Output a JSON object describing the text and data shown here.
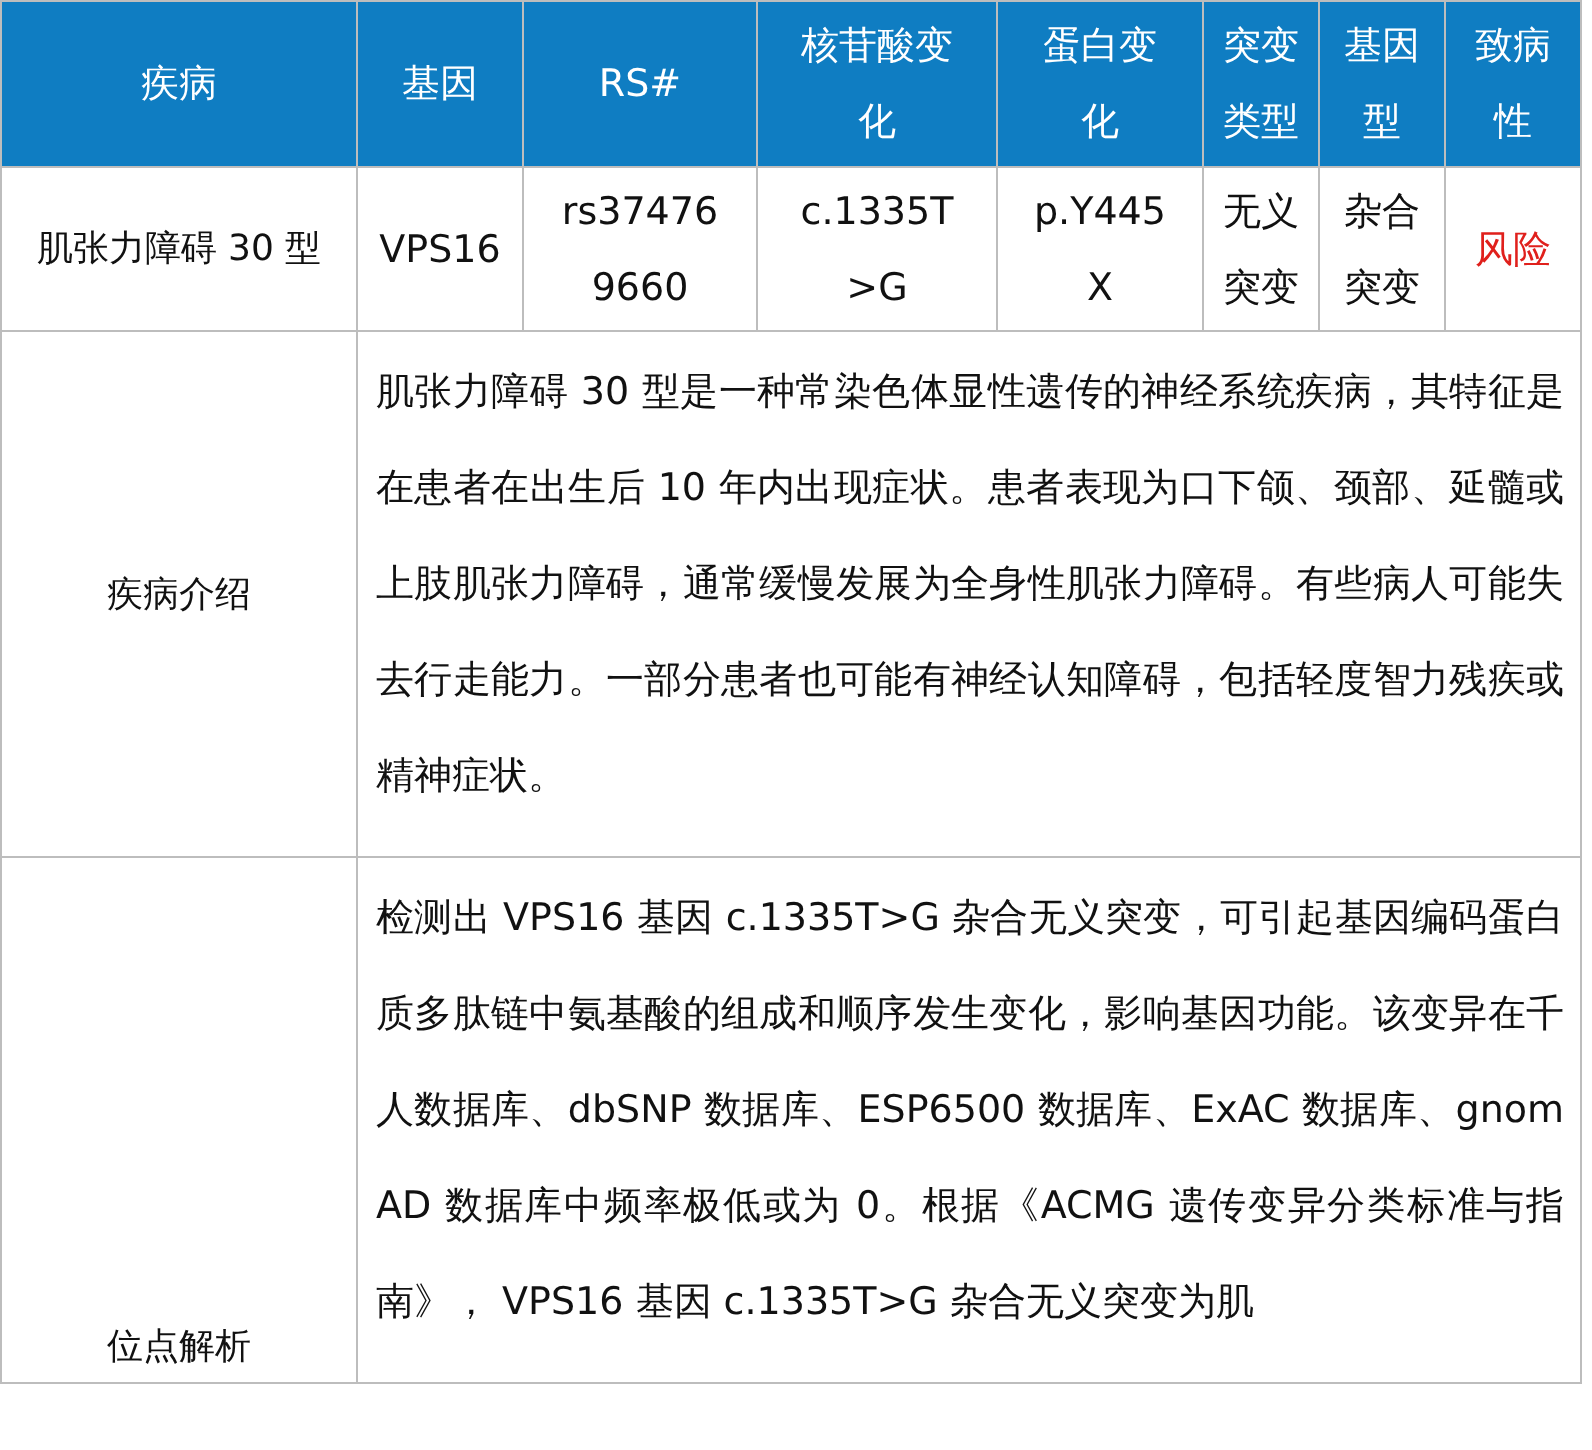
{
  "table": {
    "columns": [
      "疾病",
      "基因",
      "RS#",
      "核苷酸变化",
      "蛋白变化",
      "突变类型",
      "基因型",
      "致病性"
    ],
    "rows": [
      {
        "cells": [
          {
            "text": "肌张力障碍 30 型"
          },
          {
            "text": "VPS16"
          },
          {
            "text": "rs374769660"
          },
          {
            "text": "c.1335T>G"
          },
          {
            "text": "p.Y445X"
          },
          {
            "text": "无义突变"
          },
          {
            "text": "杂合突变"
          },
          {
            "text": "风险",
            "color": "#e0201c"
          }
        ]
      }
    ],
    "sections": [
      {
        "label": "疾病介绍",
        "text": "肌张力障碍 30 型是一种常染色体显性遗传的神经系统疾病，其特征是在患者在出生后 10 年内出现症状。患者表现为口下颌、颈部、延髓或上肢肌张力障碍，通常缓慢发展为全身性肌张力障碍。有些病人可能失去行走能力。一部分患者也可能有神经认知障碍，包括轻度智力残疾或精神症状。"
      },
      {
        "label": "位点解析",
        "text": "检测出 VPS16 基因 c.1335T>G 杂合无义突变，可引起基因编码蛋白质多肽链中氨基酸的组成和顺序发生变化，影响基因功能。该变异在千人数据库、dbSNP 数据库、ESP6500 数据库、ExAC 数据库、gnomAD 数据库中频率极低或为 0。根据《ACMG 遗传变异分类标准与指南》， VPS16 基因 c.1335T>G 杂合无义突变为肌"
      }
    ]
  }
}
